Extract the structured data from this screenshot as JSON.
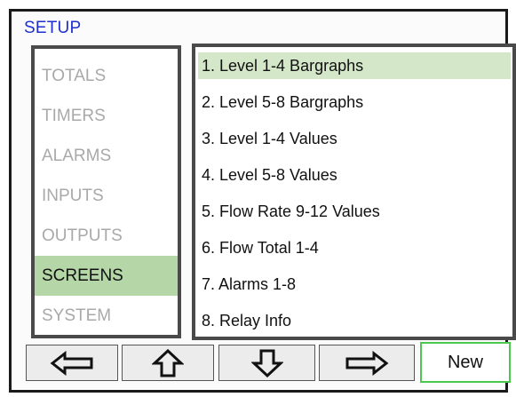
{
  "header": {
    "title": "SETUP"
  },
  "sidebar": {
    "items": [
      {
        "label": "TOTALS"
      },
      {
        "label": "TIMERS"
      },
      {
        "label": "ALARMS"
      },
      {
        "label": "INPUTS"
      },
      {
        "label": "OUTPUTS"
      },
      {
        "label": "SCREENS"
      },
      {
        "label": "SYSTEM"
      }
    ],
    "active_index": 5
  },
  "screens_list": {
    "items": [
      {
        "label": "1. Level 1-4 Bargraphs"
      },
      {
        "label": "2. Level 5-8 Bargraphs"
      },
      {
        "label": "3. Level 1-4 Values"
      },
      {
        "label": "4. Level 5-8 Values"
      },
      {
        "label": "5. Flow Rate 9-12 Values"
      },
      {
        "label": "6. Flow Total 1-4"
      },
      {
        "label": "7. Alarms 1-8"
      },
      {
        "label": "8. Relay Info"
      }
    ],
    "selected_index": 0
  },
  "toolbar": {
    "left_icon": "arrow-left-icon",
    "up_icon": "arrow-up-icon",
    "down_icon": "arrow-down-icon",
    "right_icon": "arrow-right-icon",
    "new_label": "New"
  },
  "colors": {
    "title": "#1f2fd0",
    "active_sidebar": "#b5d6a7",
    "selected_row": "#d4e8c9",
    "new_button_border": "#4cc94c"
  }
}
